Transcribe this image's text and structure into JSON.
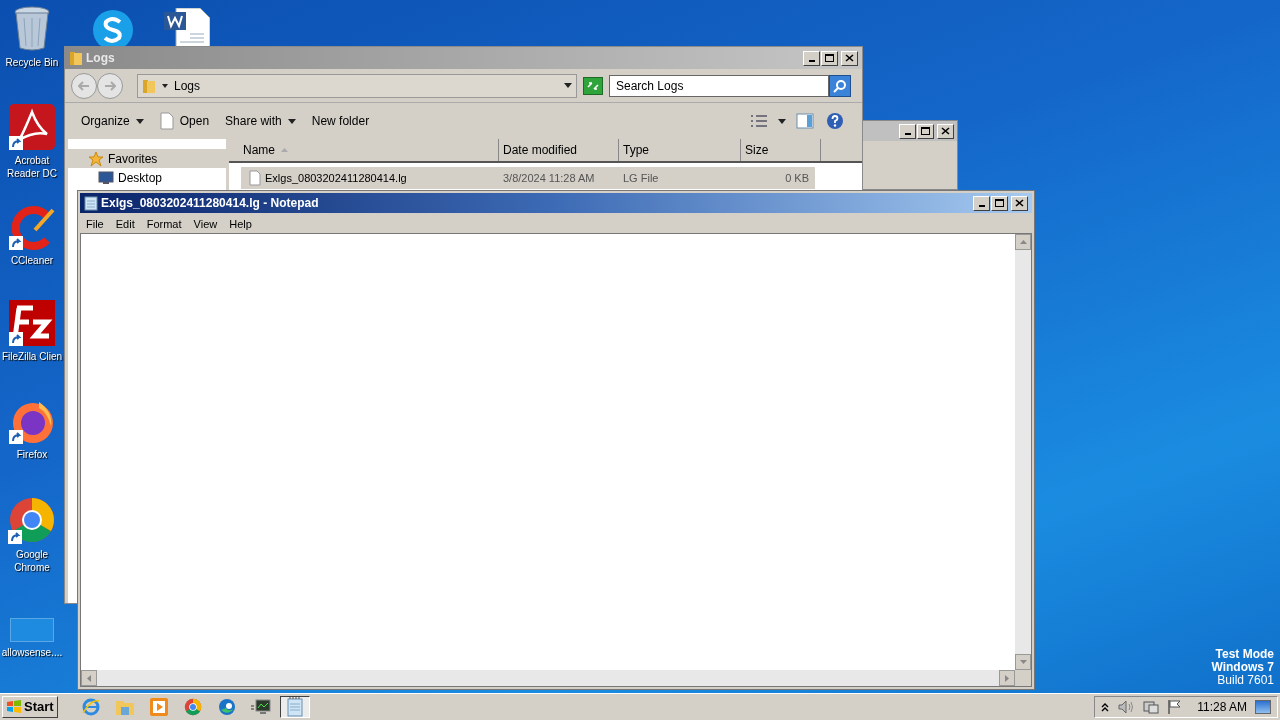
{
  "desktop_icons": [
    {
      "kind": "recycle",
      "label": "Recycle Bin"
    },
    {
      "kind": "acrobat",
      "label": "Acrobat Reader DC"
    },
    {
      "kind": "ccleaner",
      "label": "CCleaner"
    },
    {
      "kind": "filezilla",
      "label": "FileZilla Clien"
    },
    {
      "kind": "firefox",
      "label": "Firefox"
    },
    {
      "kind": "chrome",
      "label": "Google Chrome"
    },
    {
      "kind": "blank",
      "label": "allowsense...."
    }
  ],
  "explorer": {
    "title": "Logs",
    "address": "Logs",
    "search_placeholder": "Search Logs",
    "commands": [
      {
        "label": "Organize",
        "dropdown": true
      },
      {
        "label": "Open",
        "dropdown": false
      },
      {
        "label": "Share with",
        "dropdown": true
      },
      {
        "label": "New folder",
        "dropdown": false
      }
    ],
    "nav": [
      {
        "kind": "star",
        "label": "Favorites"
      },
      {
        "kind": "desktop",
        "label": "Desktop"
      }
    ],
    "columns": [
      "Name",
      "Date modified",
      "Type",
      "Size"
    ],
    "rows": [
      {
        "name": "Exlgs_0803202411280414.lg",
        "date": "3/8/2024 11:28 AM",
        "type": "LG File",
        "size": "0 KB",
        "selected": true
      }
    ]
  },
  "notepad": {
    "title": "Exlgs_0803202411280414.lg - Notepad",
    "menu": [
      "File",
      "Edit",
      "Format",
      "View",
      "Help"
    ]
  },
  "desktop_text": [
    "Test Mode",
    "Windows 7",
    "Build 7601"
  ],
  "taskbar": {
    "start": "Start",
    "apps": [
      {
        "kind": "ie",
        "active": false
      },
      {
        "kind": "explorer",
        "active": false
      },
      {
        "kind": "media",
        "active": false
      },
      {
        "kind": "chrome",
        "active": false
      },
      {
        "kind": "edge",
        "active": false
      },
      {
        "kind": "monitor",
        "active": false
      },
      {
        "kind": "notepad",
        "active": true
      }
    ],
    "time": "11:28 AM"
  }
}
